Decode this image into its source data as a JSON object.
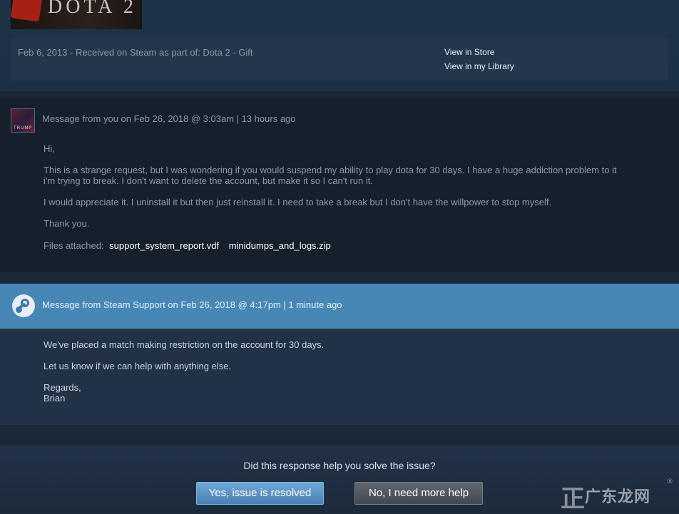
{
  "product": {
    "logo_text": "DOTA 2",
    "purchase_info": "Feb 6, 2013 -  Received on Steam as part of: Dota 2 - Gift",
    "view_in_store": "View in Store",
    "view_in_library": "View in my Library"
  },
  "user_message": {
    "avatar_caption": "TRUMP",
    "header": "Message from you on Feb 26, 2018 @ 3:03am | 13 hours ago",
    "greeting": "Hi,",
    "paragraph1_line1": "This is a strange request, but I was wondering if you would suspend my ability to play dota for 30 days. I have a huge addiction problem to it",
    "paragraph1_line2": "i'm trying to break. I don't want to delete the account, but make it so I can't run it.",
    "paragraph2": "I would appreciate it. I uninstall it but then just reinstall it. I need to take a break but I don't have the willpower to stop myself.",
    "closing": "Thank you.",
    "attachments_label": "Files attached:",
    "attachments": [
      "support_system_report.vdf",
      "minidumps_and_logs.zip"
    ]
  },
  "support_message": {
    "header": "Message from Steam Support on Feb 26, 2018 @ 4:17pm | 1 minute ago",
    "line1": "We've placed a match making restriction on the account for 30 days.",
    "line2": "Let us know if we can help with anything else.",
    "regards": "Regards,",
    "signature": "Brian"
  },
  "feedback": {
    "question": "Did this response help you solve the issue?",
    "yes_label": "Yes, issue is resolved",
    "no_label": "No, I need more help"
  },
  "watermark": {
    "mark": "正",
    "text": "广东龙网",
    "reg": "®"
  },
  "colors": {
    "page_bg": "#1b2838",
    "support_header": "#4687b5",
    "yes_button": "#5a91c4",
    "no_button": "#51575e"
  },
  "icons": [
    "dota2-logo-icon",
    "user-avatar",
    "steam-logo-icon"
  ]
}
